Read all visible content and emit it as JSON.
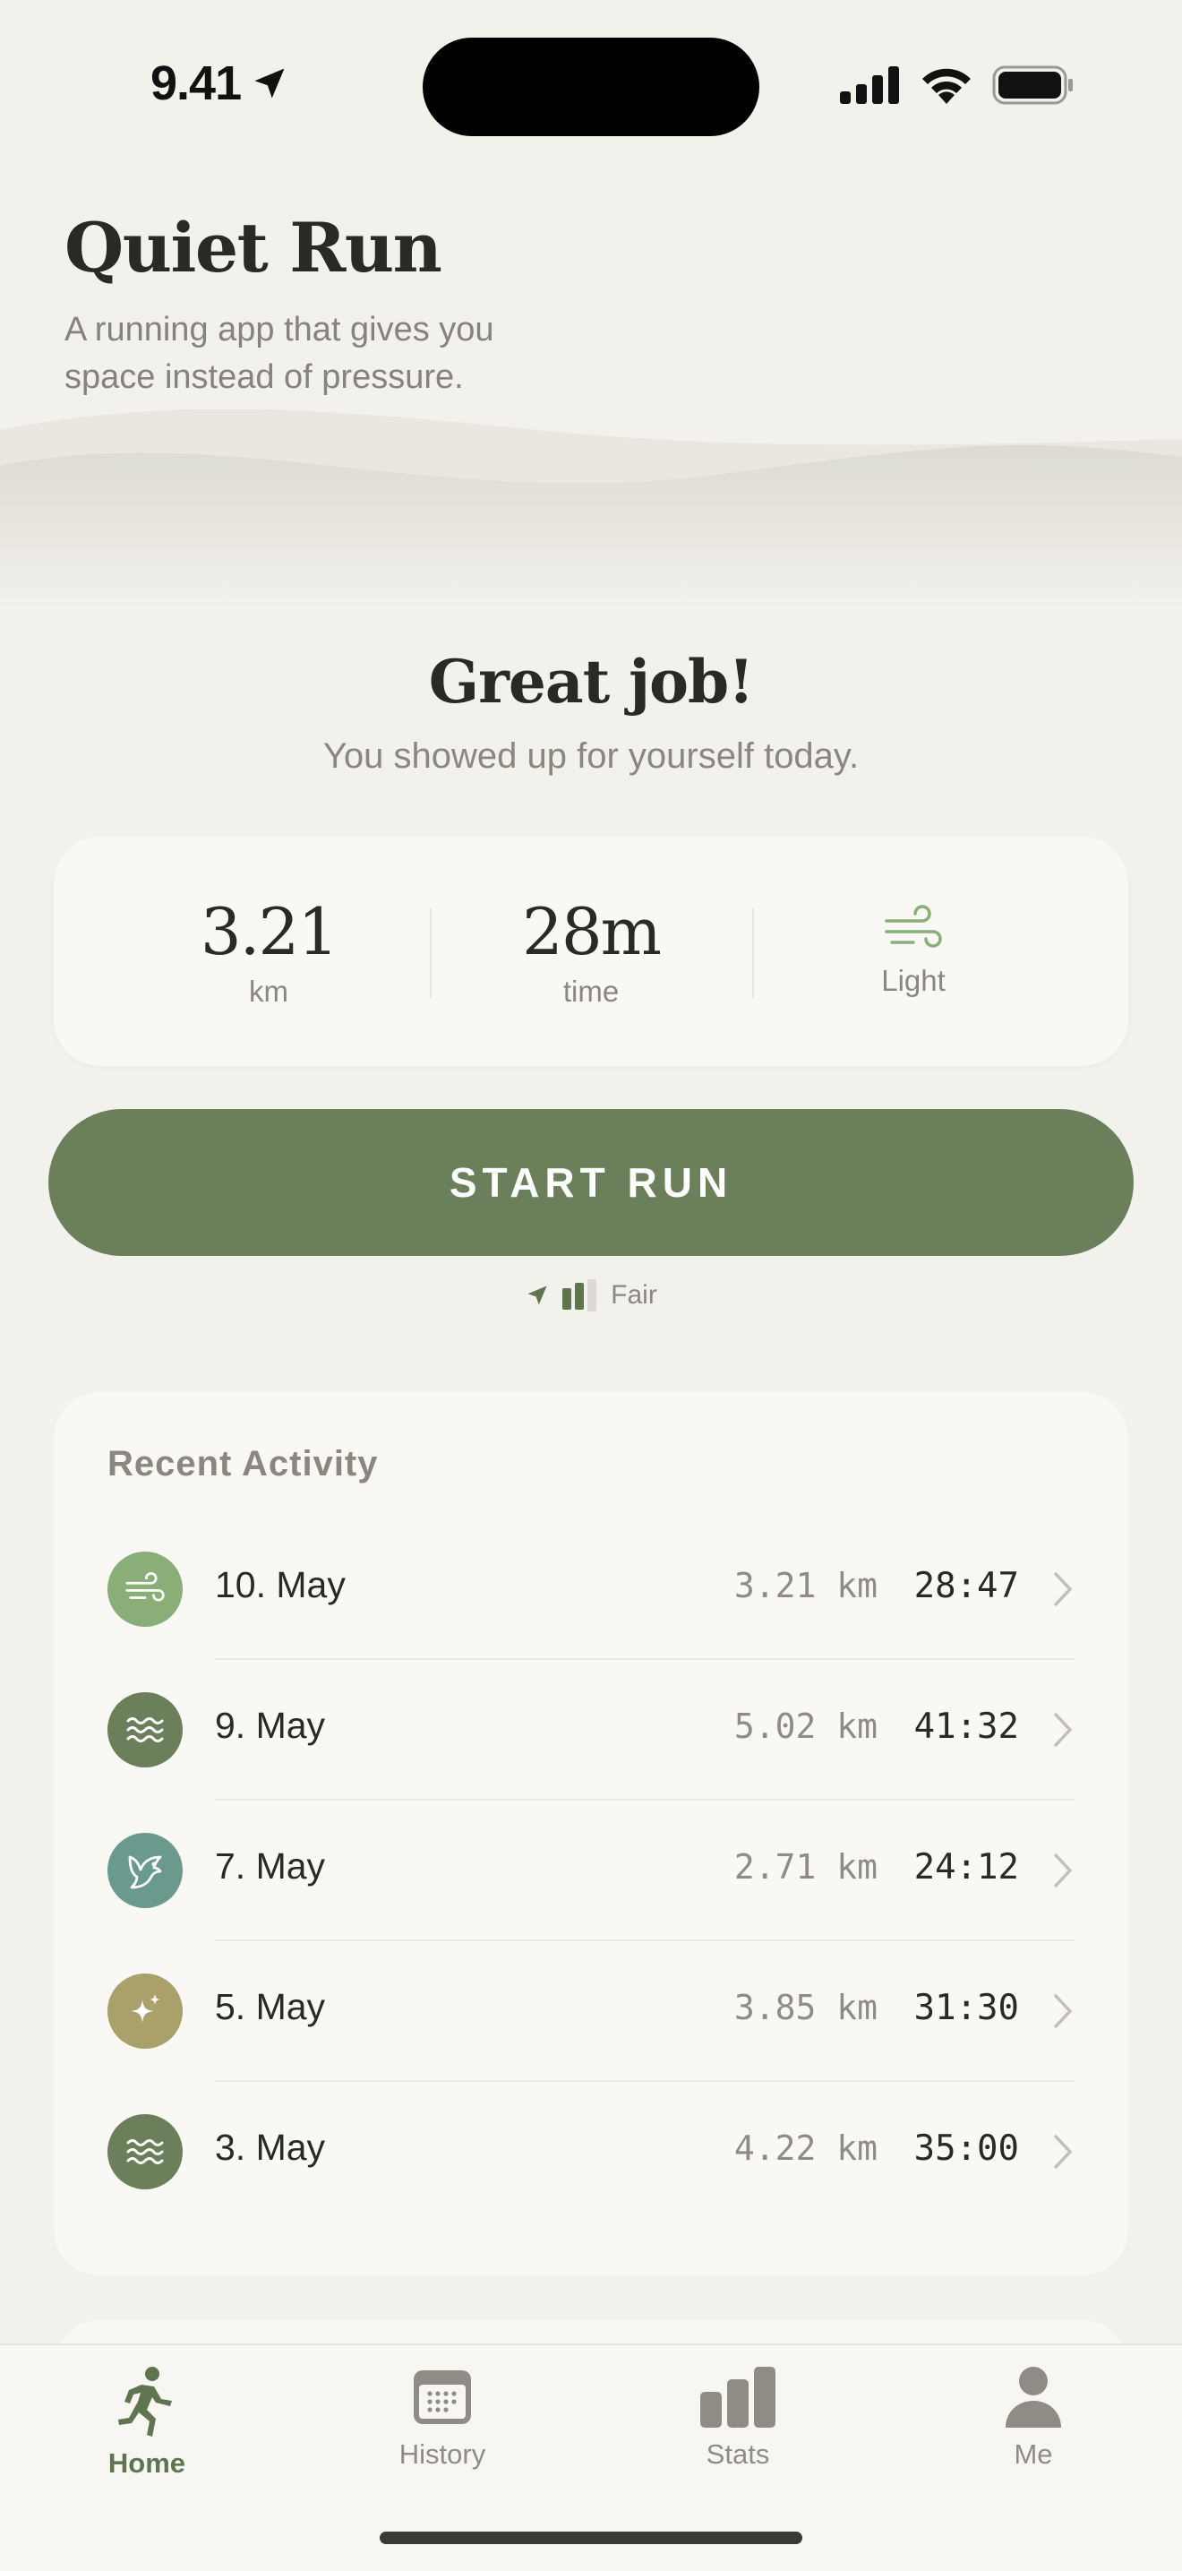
{
  "status_bar": {
    "time": "9.41"
  },
  "header": {
    "title": "Quiet Run",
    "subtitle": "A running app that gives you space instead of pressure."
  },
  "greeting": {
    "title": "Great job!",
    "subtitle": "You showed up for yourself today."
  },
  "stats": {
    "distance_value": "3.21",
    "distance_label": "km",
    "time_value": "28m",
    "time_label": "time",
    "wind_icon": "wind-icon",
    "wind_label": "Light"
  },
  "start_button": {
    "label": "START RUN"
  },
  "gps": {
    "label": "Fair",
    "level": 0.66
  },
  "recent": {
    "title": "Recent Activity",
    "items": [
      {
        "icon": "wind-icon",
        "color": "#8aae78",
        "date": "10. May",
        "distance": "3.21 km",
        "time": "28:47"
      },
      {
        "icon": "waves-icon",
        "color": "#6b7f5b",
        "date": "9. May",
        "distance": "5.02 km",
        "time": "41:32"
      },
      {
        "icon": "bird-icon",
        "color": "#6a9a8e",
        "date": "7. May",
        "distance": "2.71 km",
        "time": "24:12"
      },
      {
        "icon": "sparkle-icon",
        "color": "#a9a06a",
        "date": "5. May",
        "distance": "3.85 km",
        "time": "31:30"
      },
      {
        "icon": "waves-icon",
        "color": "#6b7f5b",
        "date": "3. May",
        "distance": "4.22 km",
        "time": "35:00"
      }
    ]
  },
  "tabbar": {
    "tabs": [
      {
        "label": "Home",
        "icon": "runner-icon",
        "active": true
      },
      {
        "label": "History",
        "icon": "calendar-icon",
        "active": false
      },
      {
        "label": "Stats",
        "icon": "bar-chart-icon",
        "active": false
      },
      {
        "label": "Me",
        "icon": "person-icon",
        "active": false
      }
    ]
  },
  "colors": {
    "accent": "#6b7f5b",
    "background": "#f3f1ec",
    "card": "#f9f8f5",
    "muted_text": "#8a877f"
  }
}
